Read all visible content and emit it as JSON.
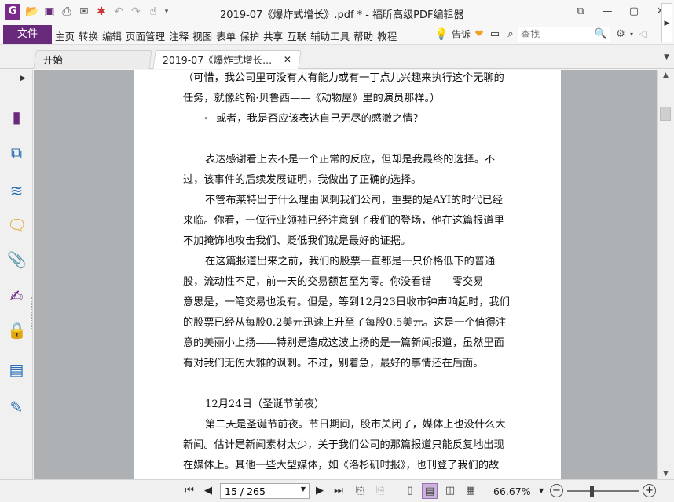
{
  "app": {
    "logo_letter": "G",
    "title": "2019-07《爆炸式增长》.pdf * - 福昕高级PDF编辑器"
  },
  "quick_access": [
    {
      "icon": "open-folder-icon",
      "glyph": "📂"
    },
    {
      "icon": "save-icon",
      "glyph": "💾"
    },
    {
      "icon": "print-icon",
      "glyph": "🖶"
    },
    {
      "icon": "email-icon",
      "glyph": "✉"
    },
    {
      "icon": "new-icon",
      "glyph": "✱"
    },
    {
      "icon": "undo-icon",
      "glyph": "↶"
    },
    {
      "icon": "redo-icon",
      "glyph": "↷"
    },
    {
      "icon": "hand-tool-icon",
      "glyph": "☝"
    },
    {
      "icon": "customize-dropdown-icon",
      "glyph": "▾"
    }
  ],
  "window_controls": {
    "restore": "⧉",
    "minimize": "—",
    "maximize": "▢",
    "close": "✕"
  },
  "menu": {
    "file": "文件",
    "items": [
      "主页",
      "转换",
      "编辑",
      "页面管理",
      "注释",
      "视图",
      "表单",
      "保护",
      "共享",
      "互联",
      "辅助工具",
      "帮助",
      "教程"
    ],
    "tell_me": "告诉",
    "search_placeholder": "查找"
  },
  "tabs": {
    "home": "开始",
    "doc": "2019-07《爆炸式增长...",
    "close": "✕"
  },
  "page": {
    "lines": [
      {
        "type": "plain",
        "text": "（可惜，我公司里可没有人有能力或有一丁点儿兴趣来执行这个无聊的"
      },
      {
        "type": "plain",
        "text": "任务，就像约翰·贝鲁西——《动物屋》里的演员那样。）"
      },
      {
        "type": "bullet",
        "text": "或者，我是否应该表达自己无尽的感激之情？"
      },
      {
        "type": "gap",
        "text": ""
      },
      {
        "type": "indent",
        "text": "表达感谢看上去不是一个正常的反应，但却是我最终的选择。不"
      },
      {
        "type": "plain",
        "text": "过，该事件的后续发展证明，我做出了正确的选择。"
      },
      {
        "type": "indent",
        "text": "不管布莱特出于什么理由讽刺我们公司，重要的是AYI的时代已经"
      },
      {
        "type": "plain",
        "text": "来临。你看，一位行业领袖已经注意到了我们的登场，他在这篇报道里"
      },
      {
        "type": "plain",
        "text": "不加掩饰地攻击我们、贬低我们就是最好的证据。"
      },
      {
        "type": "indent",
        "text": "在这篇报道出来之前，我们的股票一直都是一只价格低下的普通"
      },
      {
        "type": "plain",
        "text": "股，流动性不足，前一天的交易额甚至为零。你没看错——零交易——"
      },
      {
        "type": "plain",
        "text": "意思是，一笔交易也没有。但是，等到12月23日收市钟声响起时，我们"
      },
      {
        "type": "plain",
        "text": "的股票已经从每股0.2美元迅速上升至了每股0.5美元。这是一个值得注"
      },
      {
        "type": "plain",
        "text": "意的美丽小上扬——特别是造成这波上扬的是一篇新闻报道，虽然里面"
      },
      {
        "type": "plain",
        "text": "有对我们无伤大雅的讽刺。不过，别着急，最好的事情还在后面。"
      },
      {
        "type": "gap",
        "text": ""
      },
      {
        "type": "indent",
        "text": "12月24日（圣诞节前夜）"
      },
      {
        "type": "indent",
        "text": "第二天是圣诞节前夜。节日期间，股市关闭了，媒体上也没什么大"
      },
      {
        "type": "plain",
        "text": "新闻。估计是新闻素材太少，关于我们公司的那篇报道只能反复地出现"
      },
      {
        "type": "plain",
        "text": "在媒体上。其他一些大型媒体，如《洛杉矶时报》，也刊登了我们的故"
      }
    ]
  },
  "status": {
    "page_value": "15 / 265",
    "zoom": "66.67%",
    "zoom_fraction": 0.35
  }
}
